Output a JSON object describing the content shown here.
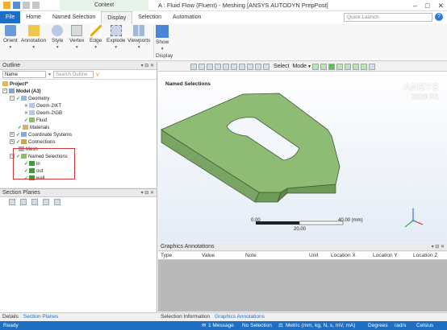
{
  "app": {
    "context_label": "Context",
    "title": "A : Fluid Flow (Fluent) - Meshing [ANSYS AUTODYN PrepPost]"
  },
  "ribbon_tabs": [
    "File",
    "Home",
    "Named Selection",
    "Display",
    "Selection",
    "Automation"
  ],
  "quick_launch_placeholder": "Quick Launch",
  "ribbon_buttons": {
    "orient": "Orient",
    "annotation": "Annotation",
    "style": "Style",
    "vertex": "Vertex",
    "edge": "Edge",
    "explode": "Explode",
    "viewports": "Viewports",
    "show": "Show",
    "group_display": "Display"
  },
  "outline": {
    "title": "Outline",
    "name_filter": "Name",
    "search_placeholder": "Search Outline",
    "tree": {
      "project": "Project*",
      "model": "Model (A3)",
      "geometry": "Geometry",
      "geom_kt": "Geom-2\\KT",
      "geom_gb": "Geom-2\\GB",
      "fluid": "Fluid",
      "materials": "Materials",
      "coordinate_systems": "Coordinate Systems",
      "connections": "Connections",
      "mesh": "Mesh",
      "named_selections": "Named Selections",
      "ns_in": "in",
      "ns_out": "out",
      "ns_wall": "wall"
    }
  },
  "section_planes": {
    "title": "Section Planes"
  },
  "viewport": {
    "label": "Named Selections",
    "toolbar_select": "Select",
    "toolbar_mode": "Mode",
    "brand": "ANSYS",
    "version": "2020 R1",
    "scale_min": "0.00",
    "scale_max": "40.00 (mm)",
    "scale_mid": "20.00",
    "model_color": "#8fbc75"
  },
  "graphics_annotations": {
    "title": "Graphics Annotations",
    "columns": [
      "Type",
      "Value",
      "Note",
      "Unit",
      "Location X",
      "Location Y",
      "Location Z"
    ]
  },
  "bottom_tabs": {
    "details": "Details",
    "section_planes": "Section Planes",
    "selection_information": "Selection Information",
    "graphics_annotations": "Graphics Annotations"
  },
  "status": {
    "ready": "Ready",
    "messages": "1 Message",
    "selection": "No Selection",
    "units": "Metric (mm, kg, N, s, mV, mA)",
    "angle": "Degrees",
    "rate": "rad/s",
    "temp": "Celsius"
  },
  "colors": {
    "accent": "#1e6fc4",
    "highlight_box": "#d0393b",
    "check": "#1a9a1a"
  }
}
